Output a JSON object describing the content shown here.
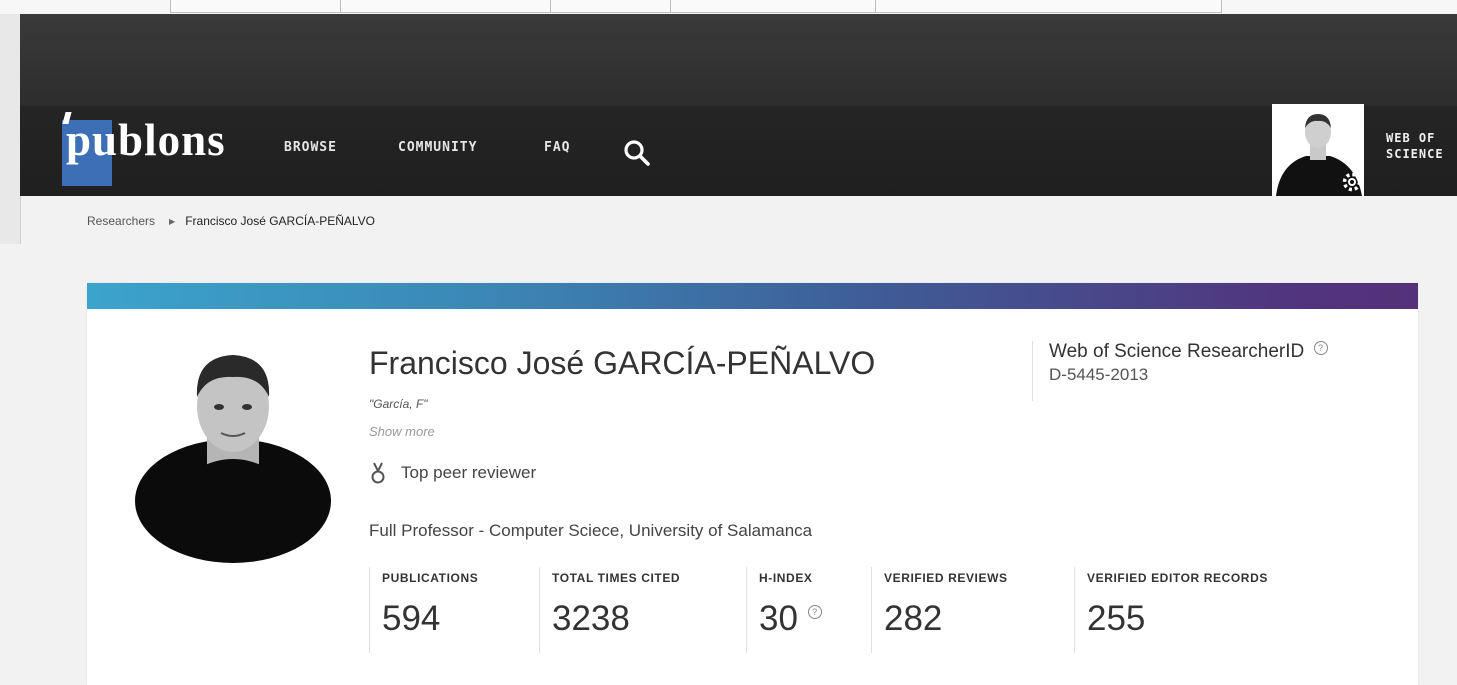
{
  "nav": {
    "logo_text": "publons",
    "browse": "BROWSE",
    "community": "COMMUNITY",
    "faq": "FAQ",
    "wos_line1": "WEB OF",
    "wos_line2": "SCIENCE"
  },
  "breadcrumb": {
    "root": "Researchers",
    "current": "Francisco José GARCÍA-PEÑALVO"
  },
  "profile": {
    "name": "Francisco José GARCÍA-PEÑALVO",
    "alias": "\"García, F\"",
    "show_more": "Show more",
    "badge": "Top peer reviewer",
    "position": "Full Professor - Computer Sciece, University of Salamanca",
    "researcher_id_label": "Web of Science ResearcherID",
    "researcher_id": "D-5445-2013"
  },
  "stats": [
    {
      "label": "PUBLICATIONS",
      "value": "594"
    },
    {
      "label": "TOTAL TIMES CITED",
      "value": "3238"
    },
    {
      "label": "H-INDEX",
      "value": "30"
    },
    {
      "label": "VERIFIED REVIEWS",
      "value": "282"
    },
    {
      "label": "VERIFIED EDITOR RECORDS",
      "value": "255"
    }
  ],
  "colors": {
    "header_bg": "#262626",
    "logo_blue": "#3c6fb6",
    "banner_start": "#3ba4cc",
    "banner_end": "#553179"
  },
  "icons": {
    "search": "search-icon",
    "settings": "gear-icon",
    "help": "question-circle-icon",
    "medal": "medal-icon",
    "breadcrumb_sep": "caret-right-icon"
  }
}
